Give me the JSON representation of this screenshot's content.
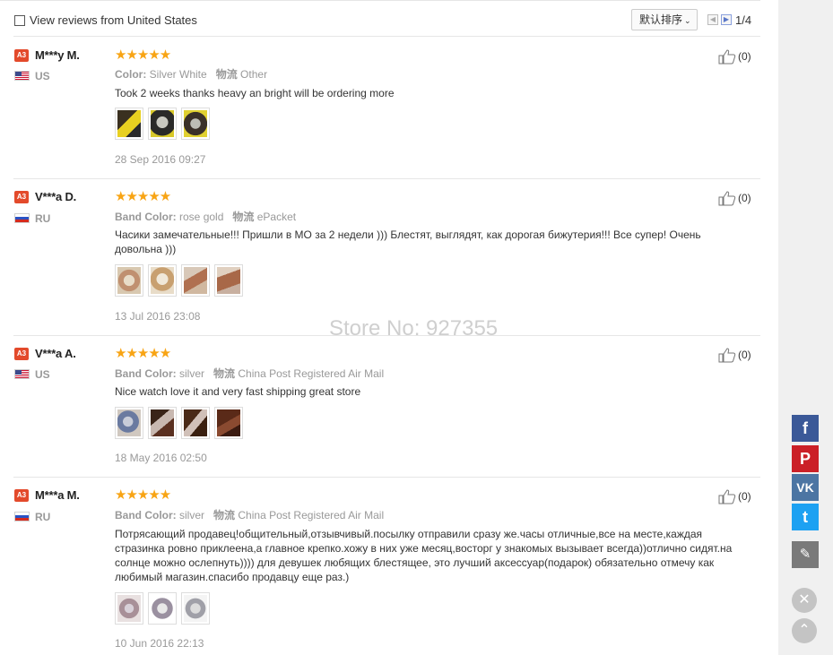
{
  "header": {
    "filter_label": "View reviews from United States",
    "sort_label": "默认排序",
    "page_indicator": "1/4"
  },
  "watermark": "Store No: 927355",
  "reviews": [
    {
      "badge": "A3",
      "username": "M***y M.",
      "country": "US",
      "rating": 5,
      "stars": "★★★★★",
      "prop1_label": "Color:",
      "prop1_value": "Silver White",
      "prop2_label": "物流",
      "prop2_value": "Other",
      "text": "Took 2 weeks thanks heavy an bright will be ordering more",
      "photos": 3,
      "date": "28 Sep 2016 09:27",
      "likes": "(0)"
    },
    {
      "badge": "A3",
      "username": "V***a D.",
      "country": "RU",
      "rating": 5,
      "stars": "★★★★★",
      "prop1_label": "Band Color:",
      "prop1_value": "rose gold",
      "prop2_label": "物流",
      "prop2_value": "ePacket",
      "text": "Часики замечательные!!! Пришли в МО за 2 недели ))) Блестят, выглядят, как дорогая бижутерия!!! Все супер! Очень довольна )))",
      "photos": 4,
      "date": "13 Jul 2016 23:08",
      "likes": "(0)"
    },
    {
      "badge": "A3",
      "username": "V***a A.",
      "country": "US",
      "rating": 5,
      "stars": "★★★★★",
      "prop1_label": "Band Color:",
      "prop1_value": "silver",
      "prop2_label": "物流",
      "prop2_value": "China Post Registered Air Mail",
      "text": "Nice watch love it and very fast shipping great store",
      "photos": 4,
      "date": "18 May 2016 02:50",
      "likes": "(0)"
    },
    {
      "badge": "A3",
      "username": "M***a M.",
      "country": "RU",
      "rating": 5,
      "stars": "★★★★★",
      "prop1_label": "Band Color:",
      "prop1_value": "silver",
      "prop2_label": "物流",
      "prop2_value": "China Post Registered Air Mail",
      "text": "Потрясающий продавец!общительный,отзывчивый.посылку отправили сразу же.часы отличные,все на месте,каждая стразинка ровно приклеена,а главное крепко.хожу в них уже месяц,восторг у знакомых вызывает всегда))отлично сидят.на солнце можно ослепнуть)))) для девушек любящих блестящее, это лучший аксессуар(подарок) обязательно отмечу как любимый магазин.спасибо продавцу еще раз.)",
      "photos": 3,
      "date": "10 Jun 2016 22:13",
      "likes": "(0)"
    }
  ],
  "share": {
    "facebook": "f",
    "pinterest": "P",
    "vk": "VK",
    "twitter": "t"
  },
  "colors": {
    "stars": "#f8a414",
    "badge": "#e34a2b",
    "facebook": "#3b5998",
    "pinterest": "#cb2027",
    "vk": "#4c75a3",
    "twitter": "#1da1f2"
  }
}
